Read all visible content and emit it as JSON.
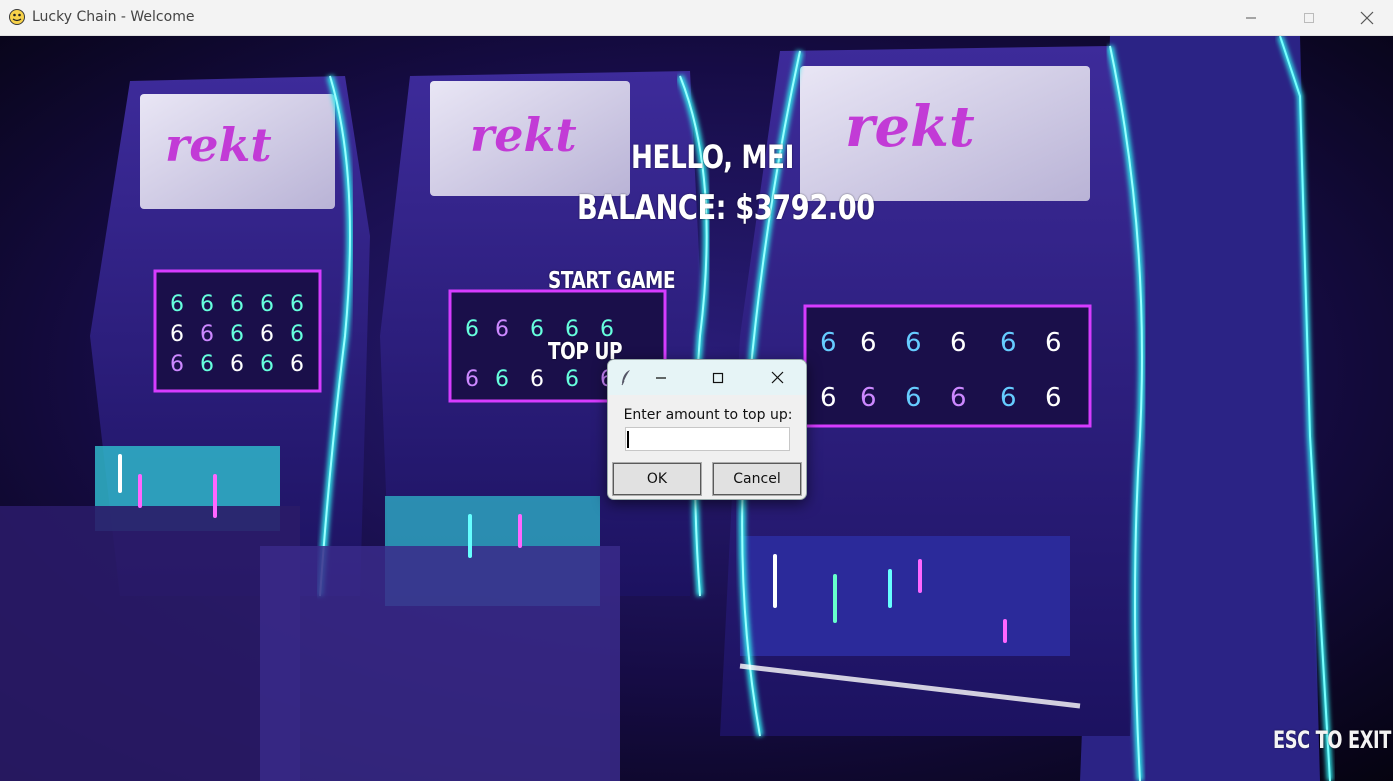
{
  "window": {
    "title": "Lucky Chain - Welcome",
    "app_icon": "pygame-snake-icon",
    "controls": [
      "minimize-icon",
      "maximize-icon",
      "close-icon"
    ]
  },
  "screen": {
    "greeting": "HELLO, MEI",
    "balance": "BALANCE: $3792.00",
    "menu": {
      "start_game": "START GAME",
      "top_up": "TOP UP"
    },
    "exit_hint": "ESC TO EXIT",
    "machine_sign": "rekt"
  },
  "dialog": {
    "icon": "feather-icon",
    "prompt": "Enter amount to top up:",
    "input_value": "",
    "ok_label": "OK",
    "cancel_label": "Cancel"
  },
  "colors": {
    "neon_cyan": "#2de2e6",
    "neon_magenta": "#d63cff",
    "deep_purple": "#2a1a6e",
    "background": "#0a0520"
  }
}
